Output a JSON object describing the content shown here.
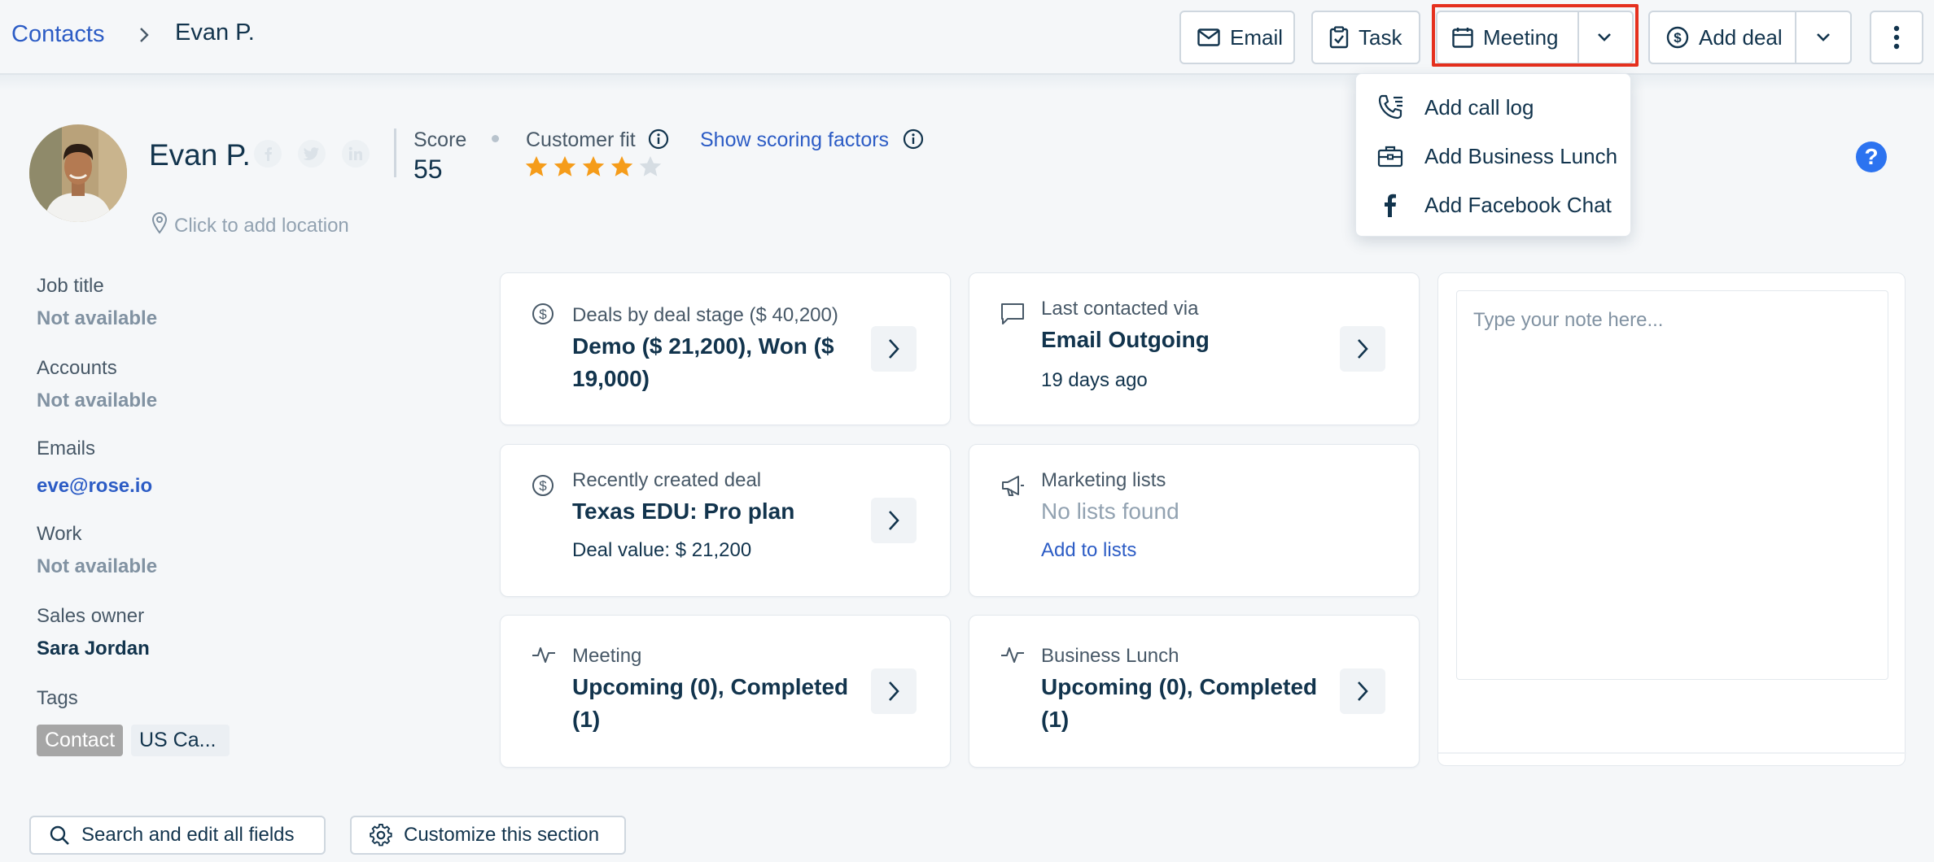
{
  "breadcrumb": {
    "root": "Contacts",
    "current": "Evan P."
  },
  "toolbar": {
    "email_label": "Email",
    "task_label": "Task",
    "meeting_label": "Meeting",
    "add_deal_label": "Add deal"
  },
  "dropdown": {
    "items": [
      {
        "label": "Add call log",
        "icon": "phone-log-icon"
      },
      {
        "label": "Add Business Lunch",
        "icon": "briefcase-icon"
      },
      {
        "label": "Add Facebook Chat",
        "icon": "facebook-icon"
      }
    ]
  },
  "profile": {
    "name": "Evan P.",
    "score_label": "Score",
    "score_value": "55",
    "customer_fit_label": "Customer fit",
    "customer_fit_stars": 4,
    "customer_fit_max": 5,
    "scoring_link": "Show scoring factors",
    "location_placeholder": "Click to add location",
    "help_glyph": "?"
  },
  "fields": {
    "job_title_label": "Job title",
    "job_title_value": "Not available",
    "accounts_label": "Accounts",
    "accounts_value": "Not available",
    "emails_label": "Emails",
    "emails_value": "eve@rose.io",
    "work_label": "Work",
    "work_value": "Not available",
    "sales_owner_label": "Sales owner",
    "sales_owner_value": "Sara Jordan",
    "tags_label": "Tags",
    "tags": [
      "Contact",
      "US Ca..."
    ]
  },
  "cards": {
    "deals_stage": {
      "label": "Deals by deal stage ($ 40,200)",
      "title": "Demo ($ 21,200), Won ($ 19,000)"
    },
    "last_contacted": {
      "label": "Last contacted via",
      "title": "Email Outgoing",
      "sub": "19 days ago"
    },
    "recent_deal": {
      "label": "Recently created deal",
      "title": "Texas EDU: Pro plan",
      "sub": "Deal value: $ 21,200"
    },
    "marketing_lists": {
      "label": "Marketing lists",
      "title": "No lists found",
      "sub": "Add to lists"
    },
    "meeting": {
      "label": "Meeting",
      "title": "Upcoming (0), Completed (1)"
    },
    "business_lunch": {
      "label": "Business Lunch",
      "title": "Upcoming (0), Completed (1)"
    }
  },
  "note": {
    "placeholder": "Type your note here..."
  },
  "footer": {
    "search_fields_label": "Search and edit all fields",
    "customize_label": "Customize this section"
  },
  "colors": {
    "link": "#2c5cc5",
    "star_filled": "#f59c1a",
    "star_empty": "#d6dde3",
    "highlight": "#e5301e",
    "help": "#2c73f0"
  }
}
